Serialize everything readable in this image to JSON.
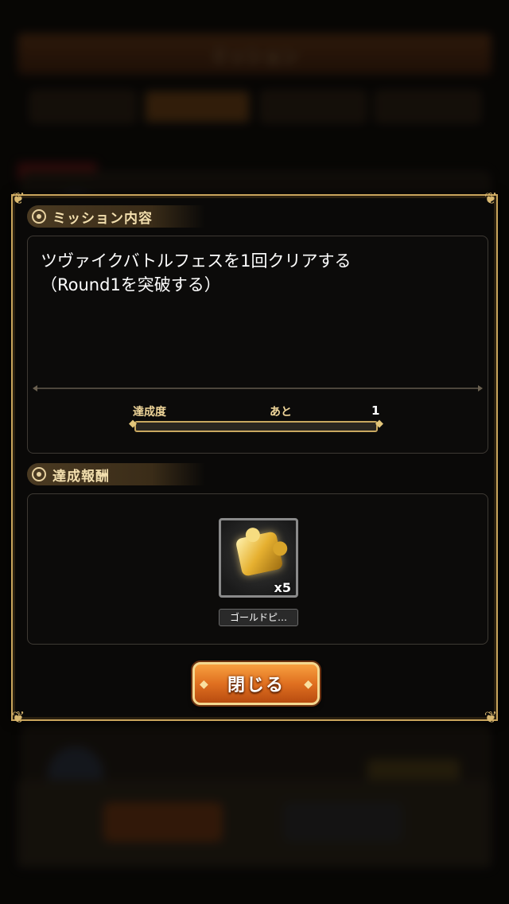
{
  "mission_section": {
    "label": "ミッション内容",
    "description_line1": "ツヴァイクバトルフェスを1回クリアする",
    "description_line2": "（Round1を突破する）",
    "progress_label": "達成度",
    "remaining_label": "あと",
    "remaining_value": "1",
    "progress": 0
  },
  "reward_section": {
    "label": "達成報酬",
    "item_quantity": "x5",
    "item_name": "ゴールドピ…",
    "item_icon": "gold-puzzle-piece-icon"
  },
  "close_button": {
    "label": "閉じる"
  },
  "background": {
    "header_title": "ミッション"
  }
}
